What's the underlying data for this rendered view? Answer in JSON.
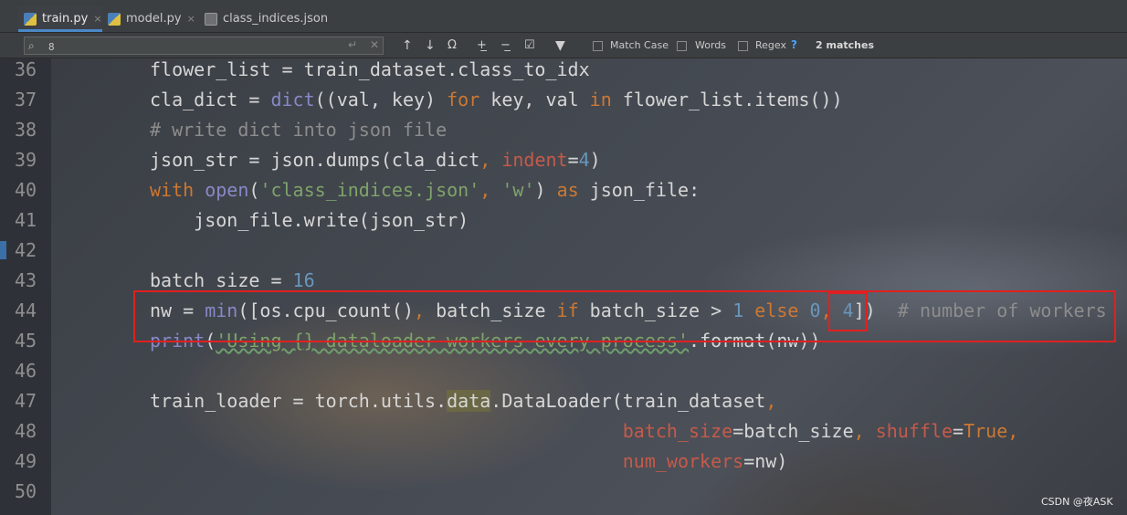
{
  "tabs": [
    {
      "label": "train.py",
      "close": "×",
      "active": true,
      "icon": "python-file-icon"
    },
    {
      "label": "model.py",
      "close": "×",
      "active": false,
      "icon": "python-file-icon"
    },
    {
      "label": "class_indices.json",
      "close": "",
      "active": false,
      "icon": "json-file-icon"
    }
  ],
  "search": {
    "value": "8",
    "prev_icon": "↑",
    "next_icon": "↓",
    "options": {
      "match_case": "Match Case",
      "words": "Words",
      "regex": "Regex",
      "help": "?"
    },
    "matches": "2 matches"
  },
  "lines": [
    {
      "n": "36",
      "tokens": [
        [
          "",
          "flower_list = train_dataset.class_to_idx"
        ]
      ]
    },
    {
      "n": "37",
      "tokens": [
        [
          "",
          "cla_dict = "
        ],
        [
          "bi",
          "dict"
        ],
        [
          "",
          "((val, key) "
        ],
        [
          "kw",
          "for"
        ],
        [
          "",
          " key, val "
        ],
        [
          "kw",
          "in"
        ],
        [
          "",
          " flower_list.items())"
        ]
      ]
    },
    {
      "n": "38",
      "tokens": [
        [
          "cmt",
          "# write dict into json file"
        ]
      ]
    },
    {
      "n": "39",
      "tokens": [
        [
          "",
          "json_str = json.dumps(cla_dict"
        ],
        [
          "kw",
          ", "
        ],
        [
          "param",
          "indent"
        ],
        [
          "",
          "="
        ],
        [
          "num",
          "4"
        ],
        [
          "",
          ")"
        ]
      ]
    },
    {
      "n": "40",
      "tokens": [
        [
          "kw",
          "with "
        ],
        [
          "bi",
          "open"
        ],
        [
          "",
          "("
        ],
        [
          "str",
          "'class_indices.json'"
        ],
        [
          "kw",
          ", "
        ],
        [
          "str",
          "'w'"
        ],
        [
          "",
          ") "
        ],
        [
          "kw",
          "as"
        ],
        [
          "",
          " json_file:"
        ]
      ]
    },
    {
      "n": "41",
      "tokens": [
        [
          "",
          "    json_file.write(json_str)"
        ]
      ]
    },
    {
      "n": "42",
      "tokens": []
    },
    {
      "n": "43",
      "tokens": [
        [
          "",
          "batch_size = "
        ],
        [
          "num",
          "16"
        ]
      ]
    },
    {
      "n": "44",
      "tokens": [
        [
          "",
          "nw = "
        ],
        [
          "bi",
          "min"
        ],
        [
          "",
          "([os.cpu_count()"
        ],
        [
          "kw",
          ", "
        ],
        [
          "",
          "batch_size "
        ],
        [
          "kw",
          "if"
        ],
        [
          "",
          " batch_size > "
        ],
        [
          "num",
          "1"
        ],
        [
          "kw",
          " else "
        ],
        [
          "num",
          "0"
        ],
        [
          "kw",
          ", "
        ],
        [
          "num",
          "4"
        ],
        [
          "",
          "])  "
        ],
        [
          "cmt",
          "# number of workers"
        ]
      ]
    },
    {
      "n": "45",
      "tokens": [
        [
          "bi",
          "print"
        ],
        [
          "",
          "("
        ],
        [
          "str",
          "'Using {} dataloader workers every process'"
        ],
        [
          "",
          ".format(nw))"
        ]
      ]
    },
    {
      "n": "46",
      "tokens": []
    },
    {
      "n": "47",
      "tokens": [
        [
          "",
          "train_loader = torch.utils."
        ],
        [
          "hl",
          "data"
        ],
        [
          "",
          ".DataLoader(train_dataset"
        ],
        [
          "kw",
          ","
        ]
      ]
    },
    {
      "n": "48",
      "tokens": [
        [
          "",
          "                                           "
        ],
        [
          "param",
          "batch_size"
        ],
        [
          "",
          "=batch_size"
        ],
        [
          "kw",
          ", "
        ],
        [
          "param",
          "shuffle"
        ],
        [
          "",
          "="
        ],
        [
          "kw",
          "True,"
        ]
      ]
    },
    {
      "n": "49",
      "tokens": [
        [
          "",
          "                                           "
        ],
        [
          "param",
          "num_workers"
        ],
        [
          "",
          "=nw)"
        ]
      ]
    },
    {
      "n": "50",
      "tokens": []
    }
  ],
  "watermark": "CSDN @夜ASK"
}
